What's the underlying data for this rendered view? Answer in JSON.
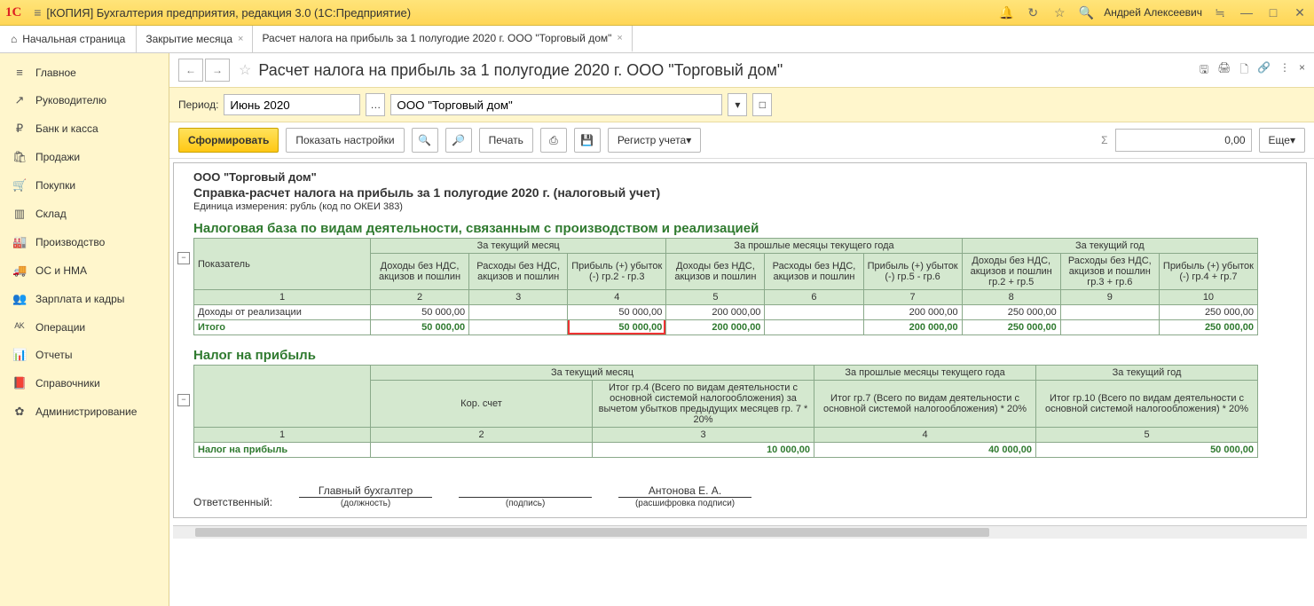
{
  "window": {
    "title": "[КОПИЯ] Бухгалтерия предприятия, редакция 3.0  (1С:Предприятие)",
    "user": "Андрей Алексеевич"
  },
  "tabs": {
    "home": "Начальная страница",
    "t1": "Закрытие месяца",
    "t2": "Расчет налога на прибыль за 1 полугодие 2020 г. ООО \"Торговый дом\""
  },
  "sidebar": [
    {
      "icon": "≡",
      "label": "Главное"
    },
    {
      "icon": "↗",
      "label": "Руководителю"
    },
    {
      "icon": "₽",
      "label": "Банк и касса"
    },
    {
      "icon": "🛍",
      "label": "Продажи"
    },
    {
      "icon": "🛒",
      "label": "Покупки"
    },
    {
      "icon": "▥",
      "label": "Склад"
    },
    {
      "icon": "🏭",
      "label": "Производство"
    },
    {
      "icon": "🚚",
      "label": "ОС и НМА"
    },
    {
      "icon": "👥",
      "label": "Зарплата и кадры"
    },
    {
      "icon": "ᴬᴷ",
      "label": "Операции"
    },
    {
      "icon": "📊",
      "label": "Отчеты"
    },
    {
      "icon": "📕",
      "label": "Справочники"
    },
    {
      "icon": "✿",
      "label": "Администрирование"
    }
  ],
  "page": {
    "title": "Расчет налога на прибыль за 1 полугодие 2020 г. ООО \"Торговый дом\"",
    "period_label": "Период:",
    "period_value": "Июнь 2020",
    "org_value": "ООО \"Торговый дом\"",
    "btn_form": "Сформировать",
    "btn_settings": "Показать настройки",
    "btn_print": "Печать",
    "btn_register": "Регистр учета",
    "sum": "0,00",
    "btn_more": "Еще"
  },
  "report": {
    "org": "ООО \"Торговый дом\"",
    "title": "Справка-расчет налога на прибыль за 1 полугодие 2020 г. (налоговый учет)",
    "unit": "Единица измерения:  рубль (код по ОКЕИ 383)",
    "sec1": "Налоговая база по видам деятельности, связанным с производством и реализацией",
    "h_indicator": "Показатель",
    "h_cur_month": "За текущий месяц",
    "h_prev_months": "За прошлые месяцы текущего года",
    "h_cur_year": "За текущий год",
    "h_income": "Доходы без НДС, акцизов и пошлин",
    "h_expense": "Расходы без НДС, акцизов и пошлин",
    "h_profit_23": "Прибыль (+) убыток (-) гр.2 - гр.3",
    "h_profit_56": "Прибыль (+) убыток (-) гр.5 - гр.6",
    "h_income_25": "Доходы без НДС, акцизов и пошлин гр.2 + гр.5",
    "h_expense_36": "Расходы без НДС, акцизов и пошлин гр.3 + гр.6",
    "h_profit_47": "Прибыль (+) убыток (-) гр.4 + гр.7",
    "colnums": [
      "1",
      "2",
      "3",
      "4",
      "5",
      "6",
      "7",
      "8",
      "9",
      "10"
    ],
    "row1_label": "Доходы от реализации",
    "row1": [
      "50 000,00",
      "",
      "50 000,00",
      "200 000,00",
      "",
      "200 000,00",
      "250 000,00",
      "",
      "250 000,00"
    ],
    "total_label": "Итого",
    "total": [
      "50 000,00",
      "",
      "50 000,00",
      "200 000,00",
      "",
      "200 000,00",
      "250 000,00",
      "",
      "250 000,00"
    ],
    "sec2": "Налог на прибыль",
    "h2_account": "Кор. счет",
    "h2_c3": "Итог гр.4 (Всего по видам деятельности с основной системой налогообложения) за вычетом убытков предыдущих месяцев гр. 7 * 20%",
    "h2_c4": "Итог гр.7 (Всего по видам деятельности с основной системой налогообложения) * 20%",
    "h2_c5": "Итог гр.10 (Всего по видам деятельности с основной системой налогообложения) * 20%",
    "colnums2": [
      "1",
      "2",
      "3",
      "4",
      "5"
    ],
    "row2_label": "Налог на прибыль",
    "row2": [
      "",
      "10 000,00",
      "40 000,00",
      "50 000,00"
    ],
    "resp_label": "Ответственный:",
    "sign_pos_val": "Главный бухгалтер",
    "sign_pos": "(должность)",
    "sign_sig": "(подпись)",
    "sign_name_val": "Антонова Е. А.",
    "sign_name": "(расшифровка подписи)"
  }
}
